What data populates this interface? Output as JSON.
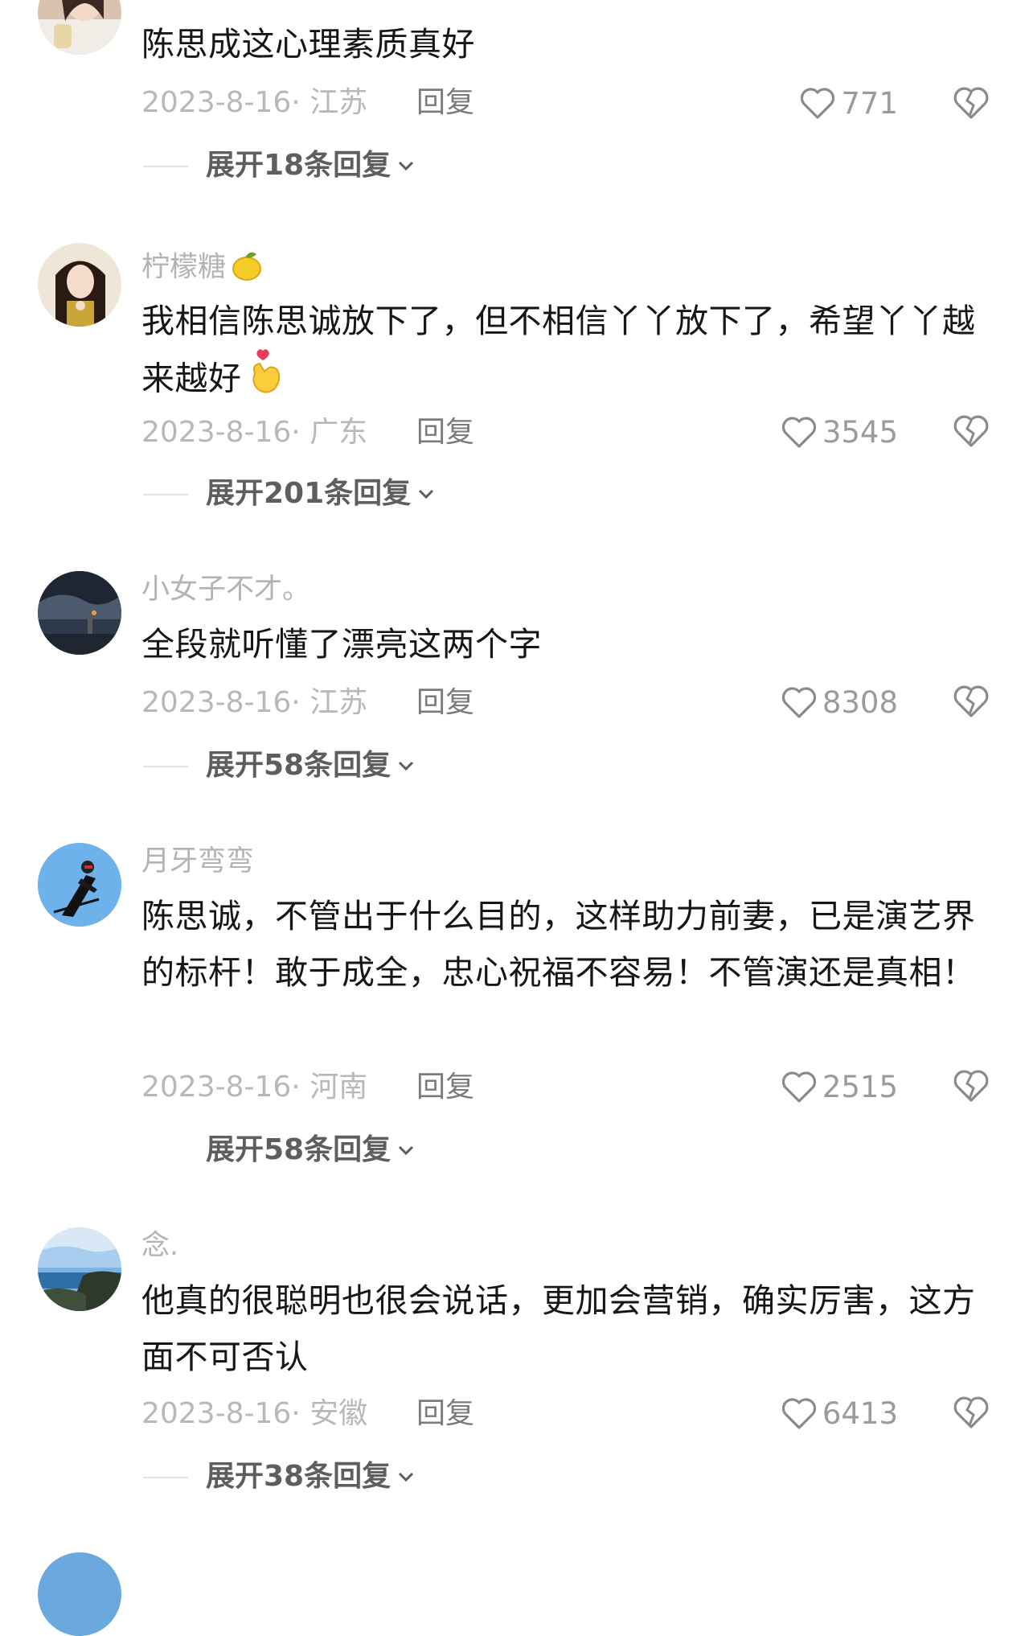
{
  "comments": [
    {
      "username": "",
      "text": "陈思成这心理素质真好",
      "date_location": "2023-8-16· 江苏",
      "reply_label": "回复",
      "likes": "771",
      "expand_label": "展开18条回复"
    },
    {
      "username": "柠檬糖",
      "username_emoji": "lemon-emoji",
      "text": "我相信陈思诚放下了，但不相信丫丫放下了，希望丫丫越来越好",
      "text_emoji": "finger-heart-emoji",
      "date_location": "2023-8-16· 广东",
      "reply_label": "回复",
      "likes": "3545",
      "expand_label": "展开201条回复"
    },
    {
      "username": "小女子不才。",
      "text": "全段就听懂了漂亮这两个字",
      "date_location": "2023-8-16· 江苏",
      "reply_label": "回复",
      "likes": "8308",
      "expand_label": "展开58条回复"
    },
    {
      "username": "月牙弯弯",
      "text": "陈思诚，不管出于什么目的，这样助力前妻，已是演艺界的标杆！敢于成全，忠心祝福不容易！不管演还是真相！",
      "date_location": "2023-8-16· 河南",
      "reply_label": "回复",
      "likes": "2515",
      "expand_label": "展开58条回复"
    },
    {
      "username": "念.",
      "text": "他真的很聪明也很会说话，更加会营销，确实厉害，这方面不可否认",
      "date_location": "2023-8-16· 安徽",
      "reply_label": "回复",
      "likes": "6413",
      "expand_label": "展开38条回复"
    }
  ],
  "icons": {
    "like": "heart-outline-icon",
    "dislike": "broken-heart-outline-icon",
    "expand": "chevron-down-icon"
  },
  "colors": {
    "text": "#161616",
    "meta": "#b8b8b8",
    "reply": "#7b7b7b",
    "expand": "#5e5e5e"
  }
}
